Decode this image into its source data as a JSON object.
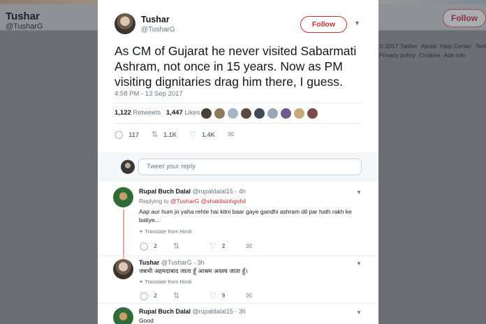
{
  "background": {
    "name": "Tushar",
    "handle": "@TusharG",
    "follow_label": "Follow",
    "footer_links": [
      "© 2017 Twitter",
      "About",
      "Help Center",
      "Terms",
      "Privacy policy",
      "Cookies",
      "Ads info"
    ]
  },
  "tweet": {
    "name": "Tushar",
    "handle": "@TusharG",
    "follow_label": "Follow",
    "text": "As CM of Gujarat he never visited Sabarmati Ashram, not once in 15 years. Now as PM visiting dignitaries drag him there, I guess.",
    "timestamp": "4:58 PM - 13 Sep 2017",
    "retweets_count": "1,122",
    "retweets_label": "Retweets",
    "likes_count": "1,447",
    "likes_label": "Likes",
    "reply_count": "117",
    "retweet_count": "1.1K",
    "like_count": "1.4K"
  },
  "reply_box": {
    "placeholder": "Tweet your reply"
  },
  "replies": [
    {
      "name": "Rupal Buch Dalal",
      "handle": "@rupaldalal15",
      "time": "· 4h",
      "replying_prefix": "Replying to",
      "replying_to": "@TusharG @shaktisinhgohil",
      "text": "Aap aur hum jo yaha rehte hai kitni baar gaye gandhi ashram dil par hath rakh ke batiye...",
      "translate": "Translate from Hindi",
      "reply_count": "2",
      "retweet_count": "",
      "like_count": "2"
    },
    {
      "name": "Tushar",
      "handle": "@TusharG",
      "time": "· 3h",
      "text": "जबभी अहमदाबाद जाता हूँ आश्रम अवश्य जाता हूँ।",
      "translate": "Translate from Hindi",
      "reply_count": "2",
      "retweet_count": "",
      "like_count": "9"
    },
    {
      "name": "Rupal Buch Dalal",
      "handle": "@rupaldalal15",
      "time": "· 3h",
      "text": "Good"
    }
  ],
  "colors": {
    "accent": "#c0302b",
    "thread": "#e1a6a8"
  }
}
